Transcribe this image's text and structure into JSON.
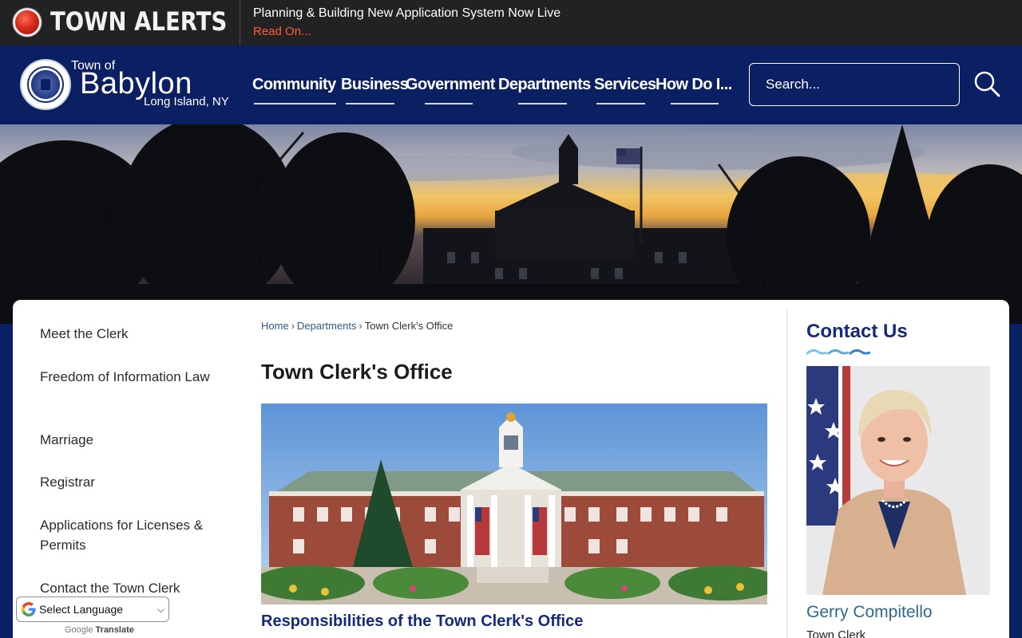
{
  "alerts": {
    "title": "TOWN ALERTS",
    "message": "Planning & Building New Application System Now Live",
    "link_label": "Read On..."
  },
  "logo": {
    "town_of": "Town of",
    "name": "Babylon",
    "location": "Long Island, NY"
  },
  "nav": {
    "items": [
      "Community",
      "Business",
      "Government",
      "Departments",
      "Services",
      "How Do I..."
    ]
  },
  "search": {
    "placeholder": "Search..."
  },
  "sidebar": {
    "items": [
      "Meet the Clerk",
      "Freedom of Information Law",
      "Marriage",
      "Registrar",
      "Applications for Licenses & Permits",
      "Contact the Town Clerk"
    ]
  },
  "breadcrumb": {
    "home": "Home",
    "departments": "Departments",
    "current": "Town Clerk's Office",
    "separator": "›"
  },
  "main": {
    "title": "Town Clerk's Office",
    "section_heading": "Responsibilities of the Town Clerk's Office"
  },
  "contact": {
    "title": "Contact Us",
    "name": "Gerry Compitello",
    "role": "Town Clerk"
  },
  "translate": {
    "select_label": "Select Language",
    "powered_google": "Google",
    "powered_label": "Translate"
  },
  "colors": {
    "navy": "#0b1f63",
    "alert_red": "#ff5a36",
    "link_blue": "#2c5a8e",
    "heading_blue": "#142a7a",
    "name_teal": "#2e6a8a"
  }
}
